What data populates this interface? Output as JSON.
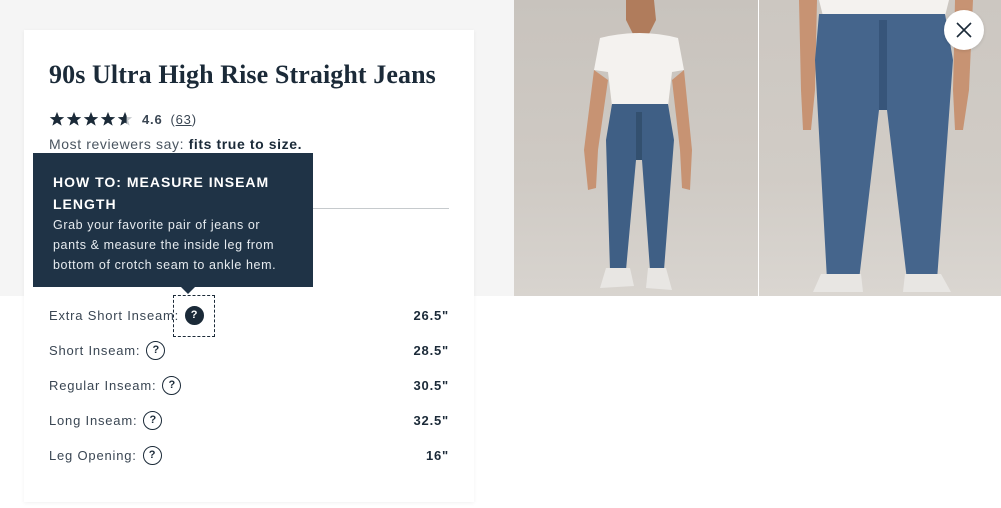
{
  "product": {
    "title": "90s Ultra High Rise Straight Jeans",
    "rating": "4.6",
    "review_count": "63",
    "stars": 4.6,
    "reviewers_prefix": "Most reviewers say:",
    "reviewers_fit": "fits true to size."
  },
  "tooltip": {
    "title": "HOW TO: MEASURE INSEAM LENGTH",
    "body": "Grab your favorite pair of jeans or pants & measure the inside leg from bottom of crotch seam to ankle hem."
  },
  "inseams": [
    {
      "label": "Extra Short Inseam:",
      "value": "26.5\""
    },
    {
      "label": "Short Inseam:",
      "value": "28.5\""
    },
    {
      "label": "Regular Inseam:",
      "value": "30.5\""
    },
    {
      "label": "Long Inseam:",
      "value": "32.5\""
    },
    {
      "label": "Leg Opening:",
      "value": "16\""
    }
  ],
  "icons": {
    "help": "question-icon",
    "close": "close-icon",
    "star": "star-icon"
  },
  "colors": {
    "navy": "#1f3346",
    "text": "#1b2a38",
    "star": "#1b2a38"
  }
}
